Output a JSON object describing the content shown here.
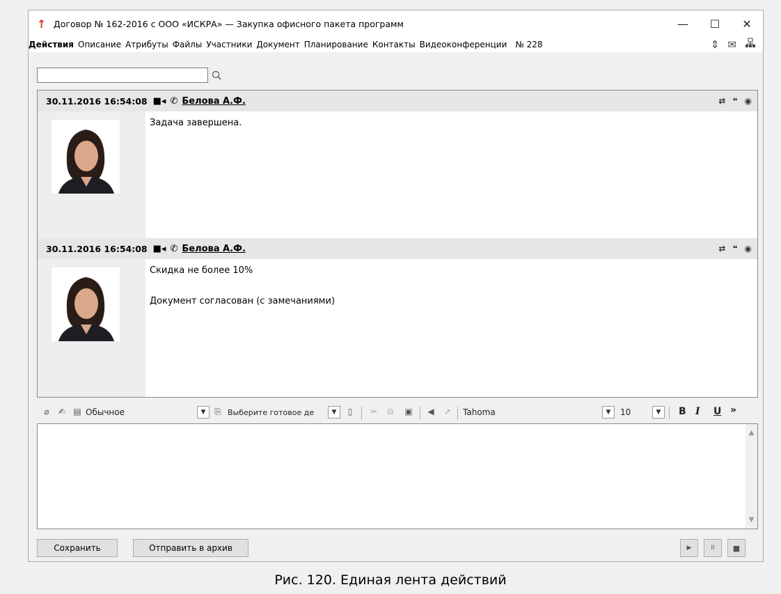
{
  "window": {
    "title": "Договор № 162-2016 с ООО «ИСКРА» — Закупка офисного пакета программ",
    "controls": {
      "minimize": "—",
      "maximize": "☐",
      "close": "✕"
    }
  },
  "menu": {
    "items": [
      "Действия",
      "Описание",
      "Атрибуты",
      "Файлы",
      "Участники",
      "Документ",
      "Планирование",
      "Контакты",
      "Видеоконференции",
      "№ 228"
    ],
    "active": "Действия"
  },
  "search": {
    "value": "",
    "placeholder": ""
  },
  "feed": {
    "entries": [
      {
        "timestamp": "30.11.2016 16:54:08",
        "author": "Белова А.Ф.",
        "lines": [
          "Задача завершена."
        ]
      },
      {
        "timestamp": "30.11.2016 16:54:08",
        "author": "Белова А.Ф.",
        "lines": [
          "Скидка не более 10%",
          "",
          "Документ согласован (с замечаниями)"
        ]
      }
    ]
  },
  "editor_toolbar": {
    "style_value": "Обычное",
    "template_value": "Выберите готовое де",
    "font_value": "Tahoma",
    "size_value": "10",
    "bold": "B",
    "italic": "I",
    "underline": "U",
    "more": "»"
  },
  "buttons": {
    "save": "Сохранить",
    "archive": "Отправить в архив",
    "play": "▶",
    "pause": "II",
    "stop": "■"
  },
  "caption": "Рис. 120. Единая лента действий"
}
